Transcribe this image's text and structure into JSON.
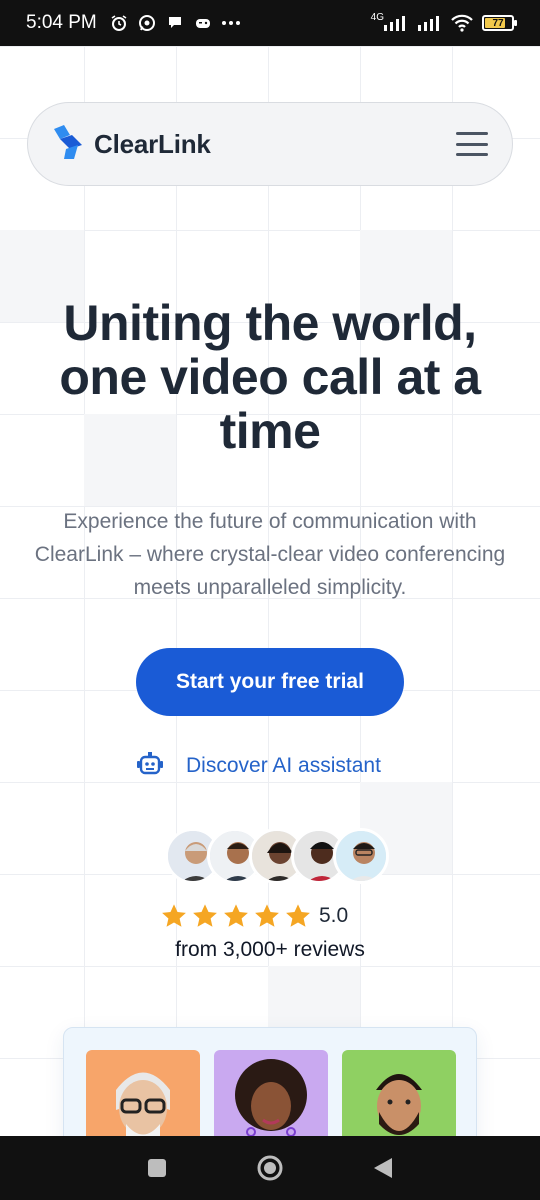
{
  "status_bar": {
    "time": "5:04 PM",
    "network": "4G",
    "battery": "77",
    "battery_level": 0.77,
    "icons": [
      "alarm-icon",
      "whatsapp-icon",
      "chat-icon",
      "game-icon",
      "more-dots-icon",
      "signal-icon",
      "signal-icon",
      "wifi-icon",
      "battery-icon"
    ]
  },
  "navbar": {
    "brand": "ClearLink",
    "logo_icon": "clearlink-logo-icon",
    "menu_icon": "hamburger-menu-icon"
  },
  "hero": {
    "title": "Uniting the world, one video call at a time",
    "subtitle": "Experience the future of communication with ClearLink – where crystal-clear video conferencing meets unparalleled simplicity.",
    "cta_label": "Start your free trial",
    "ai_link_label": "Discover AI assistant",
    "ai_icon": "robot-icon"
  },
  "social_proof": {
    "rating": "5.0",
    "stars": 5,
    "reviews": "from 3,000+ reviews"
  },
  "colors": {
    "primary": "#1a5bd6",
    "link": "#2563c9",
    "star": "#f5a623",
    "heading": "#1f2937",
    "body_text": "#6b7280"
  },
  "system_nav": {
    "items": [
      "recent-apps-icon",
      "home-icon",
      "back-icon"
    ]
  }
}
